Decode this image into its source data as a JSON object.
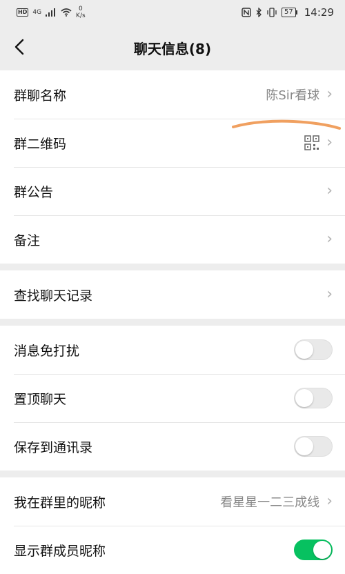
{
  "status": {
    "network_badge": "HD",
    "signal_label": "4G",
    "speed_value": "0",
    "speed_unit": "K/s",
    "battery": "57",
    "time": "14:29"
  },
  "nav": {
    "title": "聊天信息(8)"
  },
  "section1": [
    {
      "label": "群聊名称",
      "value": "陈Sir看球"
    },
    {
      "label": "群二维码"
    },
    {
      "label": "群公告"
    },
    {
      "label": "备注"
    }
  ],
  "section2": [
    {
      "label": "查找聊天记录"
    }
  ],
  "section3": [
    {
      "label": "消息免打扰",
      "on": false
    },
    {
      "label": "置顶聊天",
      "on": false
    },
    {
      "label": "保存到通讯录",
      "on": false
    }
  ],
  "section4": [
    {
      "label": "我在群里的昵称",
      "value": "看星星一二三成线"
    },
    {
      "label": "显示群成员昵称",
      "on": true
    }
  ],
  "colors": {
    "toggle_on": "#07c160",
    "annotation": "#f0a060"
  }
}
